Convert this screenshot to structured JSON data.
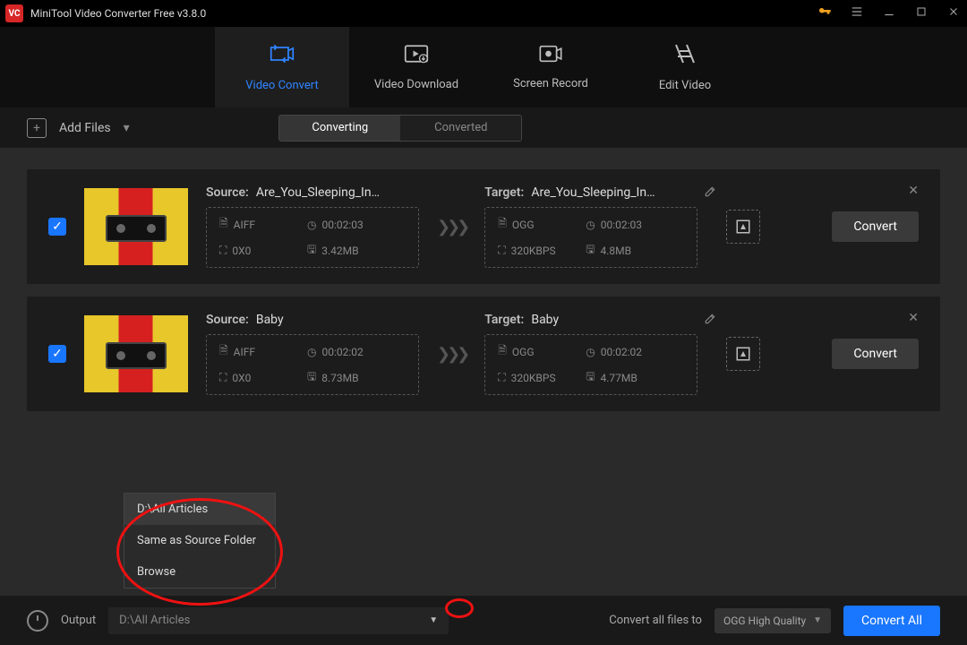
{
  "titlebar": {
    "title": "MiniTool Video Converter Free v3.8.0"
  },
  "tabs": [
    {
      "label": "Video Convert"
    },
    {
      "label": "Video Download"
    },
    {
      "label": "Screen Record"
    },
    {
      "label": "Edit Video"
    }
  ],
  "toolbar": {
    "add_files": "Add Files",
    "seg_converting": "Converting",
    "seg_converted": "Converted"
  },
  "items": [
    {
      "source_label": "Source:",
      "source_name": "Are_You_Sleeping_In…",
      "src_fmt": "AIFF",
      "src_dur": "00:02:03",
      "src_res": "0X0",
      "src_size": "3.42MB",
      "target_label": "Target:",
      "target_name": "Are_You_Sleeping_In…",
      "tgt_fmt": "OGG",
      "tgt_dur": "00:02:03",
      "tgt_br": "320KBPS",
      "tgt_size": "4.8MB",
      "convert": "Convert"
    },
    {
      "source_label": "Source:",
      "source_name": "Baby",
      "src_fmt": "AIFF",
      "src_dur": "00:02:02",
      "src_res": "0X0",
      "src_size": "8.73MB",
      "target_label": "Target:",
      "target_name": "Baby",
      "tgt_fmt": "OGG",
      "tgt_dur": "00:02:02",
      "tgt_br": "320KBPS",
      "tgt_size": "4.77MB",
      "convert": "Convert"
    }
  ],
  "popup": {
    "opt1": "D:\\All Articles",
    "opt2": "Same as Source Folder",
    "opt3": "Browse"
  },
  "bottom": {
    "output_label": "Output",
    "output_path": "D:\\All Articles",
    "convert_all_label": "Convert all files to",
    "format_name": "OGG High Quality",
    "convert_all": "Convert All"
  }
}
